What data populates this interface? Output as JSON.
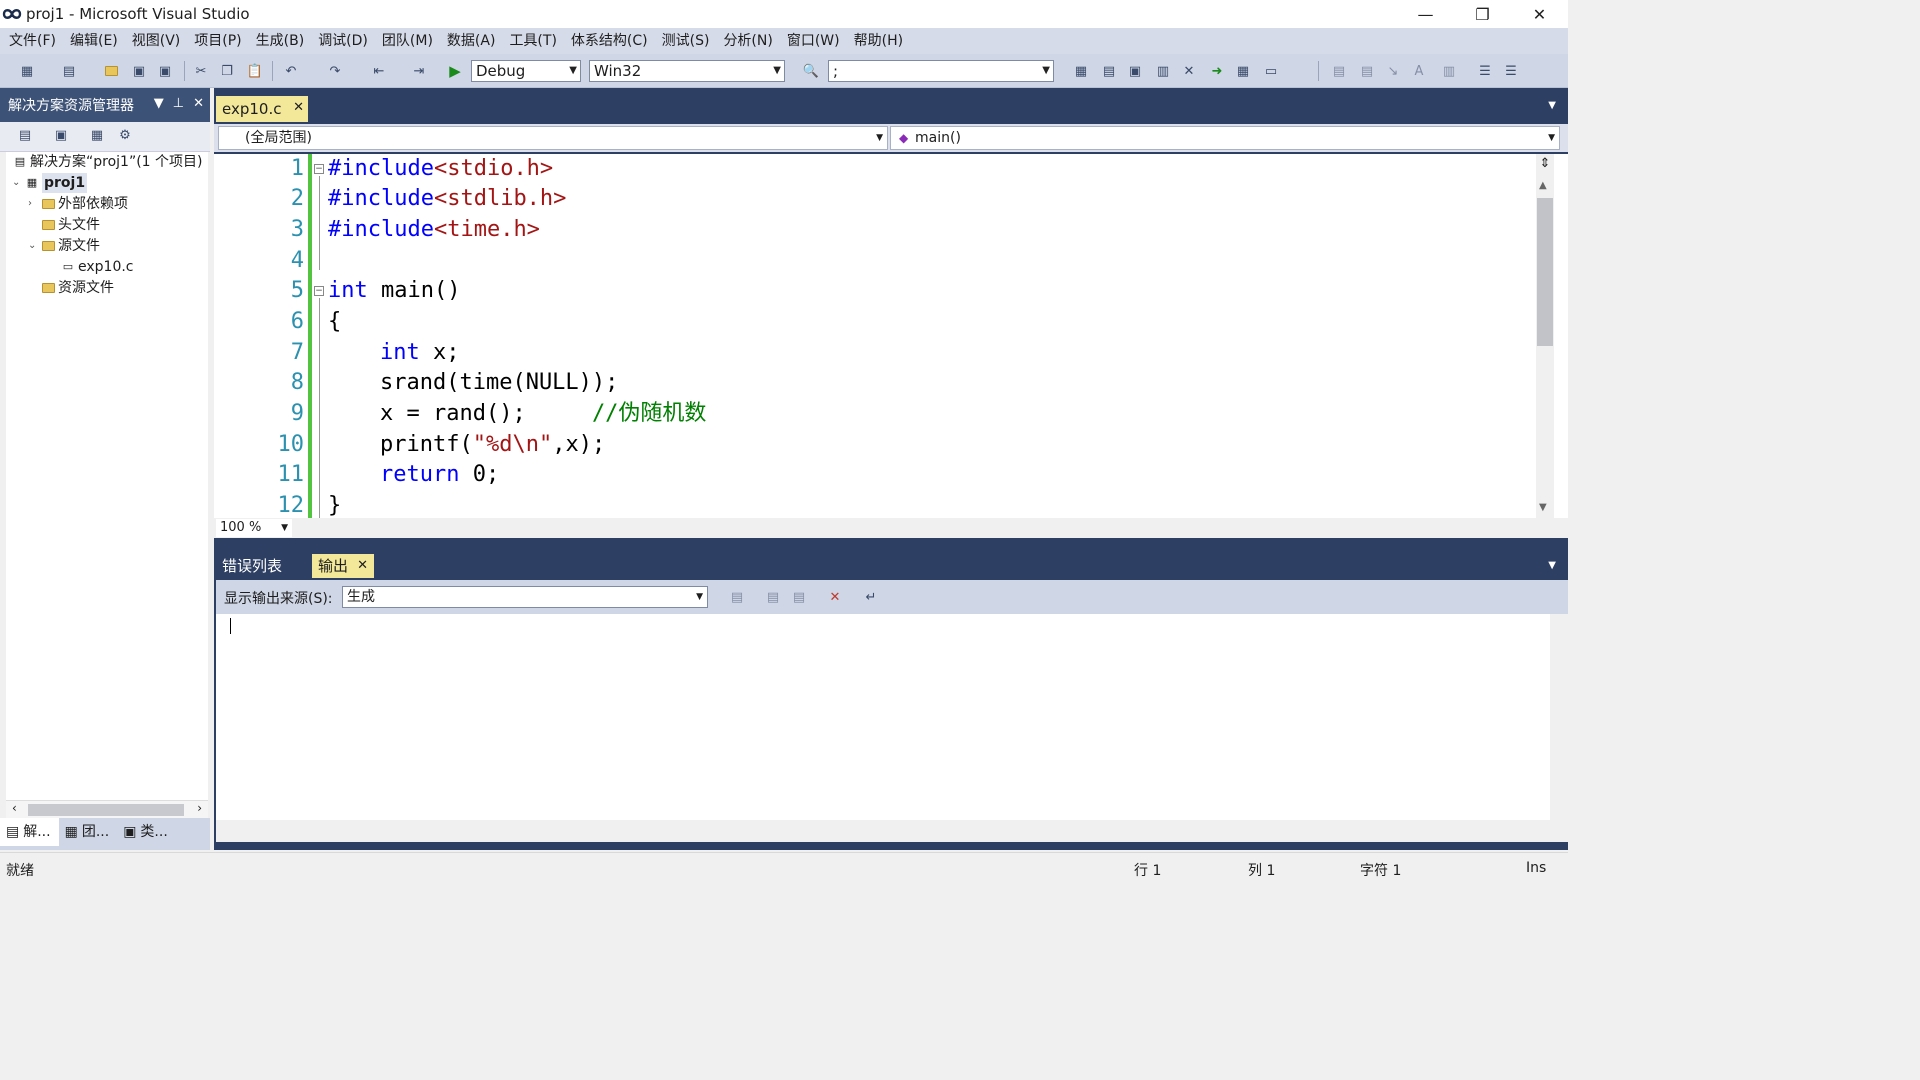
{
  "window": {
    "title": "proj1 - Microsoft Visual Studio",
    "minimize": "—",
    "restore": "❐",
    "close": "✕"
  },
  "menu": [
    "文件(F)",
    "编辑(E)",
    "视图(V)",
    "项目(P)",
    "生成(B)",
    "调试(D)",
    "团队(M)",
    "数据(A)",
    "工具(T)",
    "体系结构(C)",
    "测试(S)",
    "分析(N)",
    "窗口(W)",
    "帮助(H)"
  ],
  "toolbar": {
    "config": "Debug",
    "platform": "Win32",
    "find_value": ";"
  },
  "solution_explorer": {
    "title": "解决方案资源管理器",
    "solution": "解决方案“proj1”(1 个项目)",
    "project": "proj1",
    "external_deps": "外部依赖项",
    "header_files": "头文件",
    "source_files": "源文件",
    "file": "exp10.c",
    "resource_files": "资源文件",
    "bottom_tabs": [
      "解...",
      "团...",
      "类..."
    ]
  },
  "editor": {
    "tab": "exp10.c",
    "scope": "(全局范围)",
    "function": "main()",
    "zoom": "100 %",
    "line_numbers": [
      "1",
      "2",
      "3",
      "4",
      "5",
      "6",
      "7",
      "8",
      "9",
      "10",
      "11",
      "12"
    ],
    "code": {
      "l1_directive": "#include",
      "l1_header": "<stdio.h>",
      "l2_directive": "#include",
      "l2_header": "<stdlib.h>",
      "l3_directive": "#include",
      "l3_header": "<time.h>",
      "l5_kw": "int",
      "l5_rest": " main()",
      "l6": "{",
      "l7_kw": "int",
      "l7_rest": " x;",
      "l8": "srand(time(NULL));",
      "l9_code": "x = rand();",
      "l9_comment": "//伪随机数",
      "l10_pre": "printf(",
      "l10_str": "\"%d\\n\"",
      "l10_post": ",x);",
      "l11_kw": "return",
      "l11_rest": " 0;",
      "l12": "}"
    }
  },
  "output_panel": {
    "tabs": [
      "错误列表",
      "输出"
    ],
    "active_tab": "输出",
    "source_label": "显示输出来源(S):",
    "source_value": "生成"
  },
  "status_bar": {
    "state": "就绪",
    "line": "行 1",
    "col": "列 1",
    "char": "字符 1",
    "mode": "Ins"
  },
  "colors": {
    "accent_dark": "#2d3f63",
    "active_tab": "#f3e79a",
    "line_number": "#2b91af",
    "keyword": "#0000ff",
    "string": "#a31515",
    "comment": "#008000",
    "change_bar": "#53c43f"
  }
}
